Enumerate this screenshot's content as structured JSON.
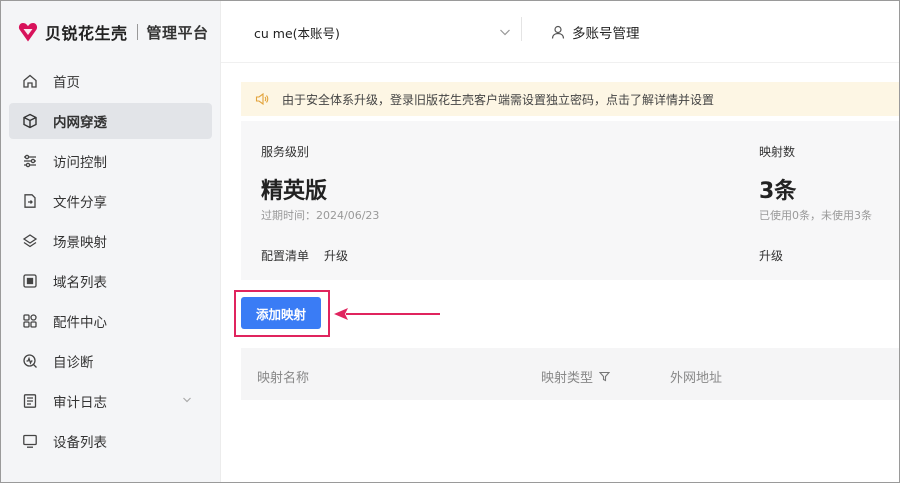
{
  "brand": {
    "name": "贝锐花生壳",
    "subtitle": "管理平台",
    "logo_color": "#d8125b"
  },
  "sidebar": {
    "items": [
      {
        "label": "首页",
        "icon": "home-icon"
      },
      {
        "label": "内网穿透",
        "icon": "cube-icon",
        "active": true
      },
      {
        "label": "访问控制",
        "icon": "sliders-icon"
      },
      {
        "label": "文件分享",
        "icon": "file-share-icon"
      },
      {
        "label": "场景映射",
        "icon": "layers-icon"
      },
      {
        "label": "域名列表",
        "icon": "domain-icon"
      },
      {
        "label": "配件中心",
        "icon": "grid-icon"
      },
      {
        "label": "自诊断",
        "icon": "diagnose-icon"
      },
      {
        "label": "审计日志",
        "icon": "log-icon",
        "expandable": true
      },
      {
        "label": "设备列表",
        "icon": "monitor-icon"
      }
    ]
  },
  "header": {
    "account": "cu me(本账号)",
    "multi_account": "多账号管理"
  },
  "notice": {
    "text": "由于安全体系升级，登录旧版花生壳客户端需设置独立密码，点击了解详情并设置",
    "bg_color": "#fdf6e4"
  },
  "service": {
    "level_label": "服务级别",
    "level_value": "精英版",
    "expiry": "过期时间：2024/06/23",
    "config_link": "配置清单",
    "upgrade_link": "升级",
    "count_label": "映射数",
    "count_value": "3条",
    "count_detail": "已使用0条，未使用3条",
    "count_upgrade": "升级"
  },
  "actions": {
    "add_mapping": "添加映射",
    "primary_color": "#3a7cf5",
    "highlight_color": "#e0245e"
  },
  "table": {
    "columns": [
      "映射名称",
      "映射类型",
      "外网地址"
    ]
  }
}
